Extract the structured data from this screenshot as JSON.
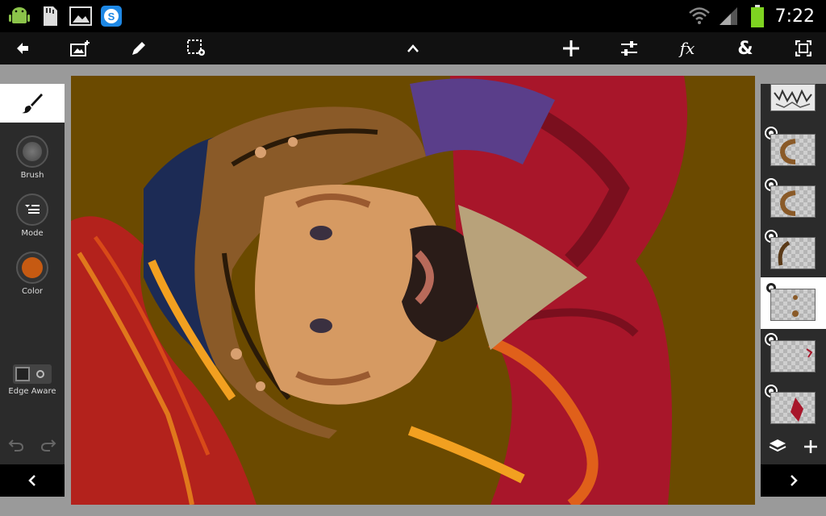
{
  "status_bar": {
    "time": "7:22",
    "icons": [
      "android-debug-icon",
      "sd-card-icon",
      "gallery-icon",
      "skype-icon",
      "wifi-icon",
      "signal-icon",
      "battery-icon"
    ],
    "battery_color": "#7ed321"
  },
  "toolbar": {
    "icons": [
      "back-arrow-icon",
      "add-image-layer-icon",
      "pencil-icon",
      "selection-settings-icon",
      "chevron-up-icon",
      "move-icon",
      "adjustments-icon",
      "effects-icon",
      "combine-icon",
      "fit-screen-icon"
    ],
    "fx_label": "fx",
    "amp_label": "&"
  },
  "left_panel": {
    "active_tool_icon": "brush-icon",
    "tools": [
      {
        "label": "Brush",
        "icon": "brush-size-icon"
      },
      {
        "label": "Mode",
        "icon": "mode-list-icon"
      },
      {
        "label": "Color",
        "icon": "color-swatch-icon",
        "color": "#c65a12"
      }
    ],
    "edge_aware_label": "Edge Aware",
    "edge_aware_on": false
  },
  "canvas": {
    "background": "#6b4a00",
    "description_icon": "painting-canvas"
  },
  "layers": {
    "selected_index": 4,
    "count": 7
  },
  "colors": {
    "toolbar_bg": "#111111",
    "panel_bg": "#2b2b2b",
    "workspace_bg": "#9a9a9a",
    "accent_orange": "#c65a12"
  }
}
